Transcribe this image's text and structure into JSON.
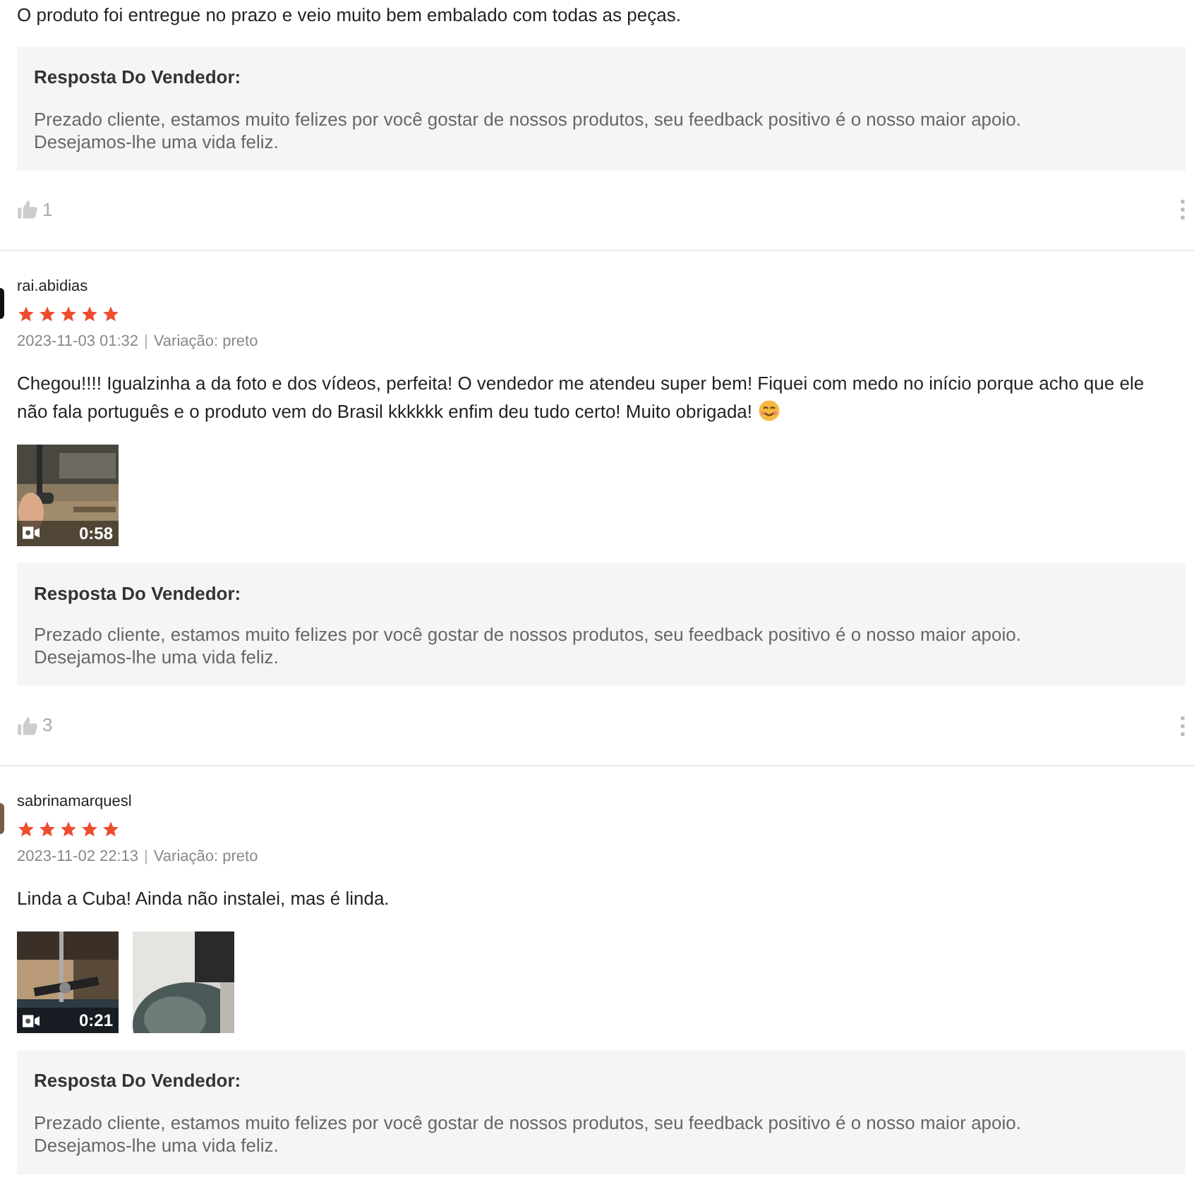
{
  "reviews": [
    {
      "text": "O produto foi entregue no prazo e veio muito bem embalado com todas as peças.",
      "reply": {
        "title": "Resposta Do Vendedor:",
        "body": "Prezado cliente, estamos muito felizes por você gostar de nossos produtos, seu feedback positivo é o nosso maior apoio. Desejamos-lhe uma vida feliz."
      },
      "likes": "1"
    },
    {
      "user": "rai.abidias",
      "stars": 5,
      "date": "2023-11-03 01:32",
      "separator": "|",
      "variation": "Variação: preto",
      "text": "Chegou!!!! Igualzinha a da foto e dos vídeos, perfeita! O vendedor me atendeu super bem! Fiquei com medo no início porque acho que ele não fala português e o produto vem do Brasil kkkkkk enfim deu tudo certo! Muito obrigada!",
      "emoji": true,
      "media": [
        {
          "kind": "video",
          "duration": "0:58"
        }
      ],
      "reply": {
        "title": "Resposta Do Vendedor:",
        "body": "Prezado cliente, estamos muito felizes por você gostar de nossos produtos, seu feedback positivo é o nosso maior apoio. Desejamos-lhe uma vida feliz."
      },
      "likes": "3"
    },
    {
      "user": "sabrinamarquesl",
      "stars": 5,
      "date": "2023-11-02 22:13",
      "separator": "|",
      "variation": "Variação: preto",
      "text": "Linda a Cuba! Ainda não instalei, mas é linda.",
      "emoji": false,
      "media": [
        {
          "kind": "video",
          "duration": "0:21"
        },
        {
          "kind": "picture"
        }
      ],
      "reply": {
        "title": "Resposta Do Vendedor:",
        "body": "Prezado cliente, estamos muito felizes por você gostar de nossos produtos, seu feedback positivo é o nosso maior apoio. Desejamos-lhe uma vida feliz."
      }
    }
  ]
}
